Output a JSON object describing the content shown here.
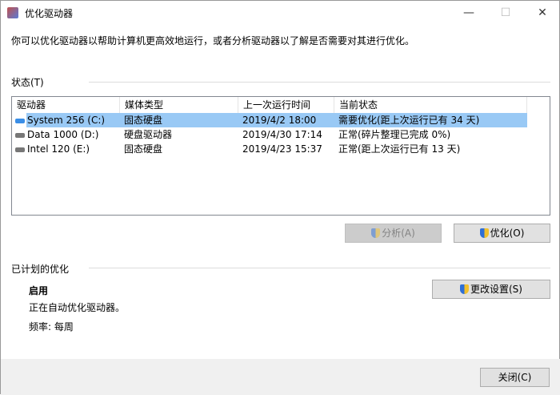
{
  "window": {
    "title": "优化驱动器",
    "minimize": "—",
    "maximize": "☐",
    "close": "✕"
  },
  "description": "你可以优化驱动器以帮助计算机更高效地运行，或者分析驱动器以了解是否需要对其进行优化。",
  "status": {
    "label": "状态(T)",
    "columns": [
      "驱动器",
      "媒体类型",
      "上一次运行时间",
      "当前状态"
    ],
    "rows": [
      {
        "drive": "System 256 (C:)",
        "media": "固态硬盘",
        "last_run": "2019/4/2 18:00",
        "state": "需要优化(距上次运行已有 34 天)"
      },
      {
        "drive": "Data 1000 (D:)",
        "media": "硬盘驱动器",
        "last_run": "2019/4/30 17:14",
        "state": "正常(碎片整理已完成 0%)"
      },
      {
        "drive": "Intel 120 (E:)",
        "media": "固态硬盘",
        "last_run": "2019/4/23 15:37",
        "state": "正常(距上次运行已有 13 天)"
      }
    ]
  },
  "buttons": {
    "analyze": "分析(A)",
    "optimize": "优化(O)",
    "change_settings": "更改设置(S)",
    "close": "关闭(C)"
  },
  "scheduled": {
    "label": "已计划的优化",
    "state": "启用",
    "detail": "正在自动优化驱动器。",
    "frequency": "频率: 每周"
  }
}
